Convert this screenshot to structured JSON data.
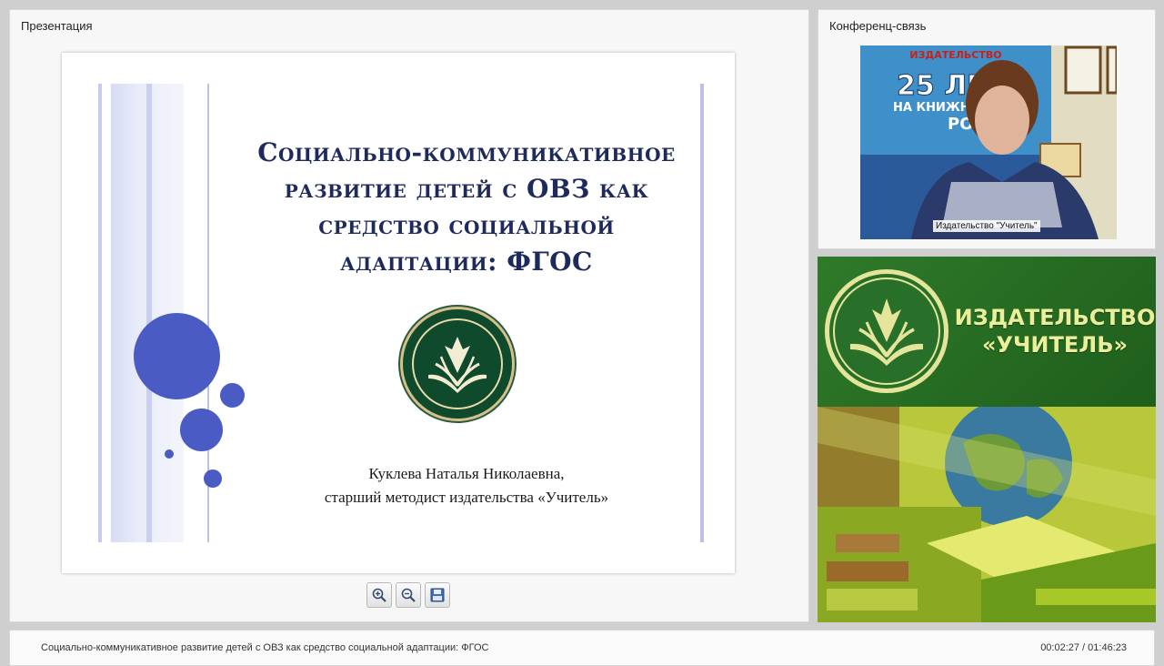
{
  "presentation": {
    "panel_title": "Презентация",
    "slide": {
      "title_lines": [
        "Социально-коммуникативное",
        "развитие детей с ОВЗ как",
        "средство социальной",
        "адаптации: ФГОС"
      ],
      "author_name": "Куклева Наталья Николаевна,",
      "author_role": "старший методист издательства «Учитель»",
      "title_color": "#1f2a5c",
      "circle_color": "#4a5bc4",
      "emblem_color": "#0f4a2c"
    },
    "toolbar": {
      "zoom_in_icon": "zoom-in-icon",
      "zoom_out_icon": "zoom-out-icon",
      "save_icon": "save-icon"
    }
  },
  "conference": {
    "panel_title": "Конференц-связь",
    "video_caption": "Издательство \"Учитель\"",
    "backdrop_lines": [
      "ИЗДАТЕЛЬСТВО",
      "25 ЛЕТ",
      "НА КНИЖНО",
      "РО"
    ]
  },
  "banner": {
    "name_line1": "ИЗДАТЕЛЬСТВО",
    "name_line2": "«УЧИТЕЛЬ»",
    "bg_color": "#2f7a2a",
    "text_color": "#ecef9a"
  },
  "footer": {
    "title": "Социально-коммуникативное развитие детей с ОВЗ как средство социальной адаптации: ФГОС",
    "time": "00:02:27 / 01:46:23"
  }
}
